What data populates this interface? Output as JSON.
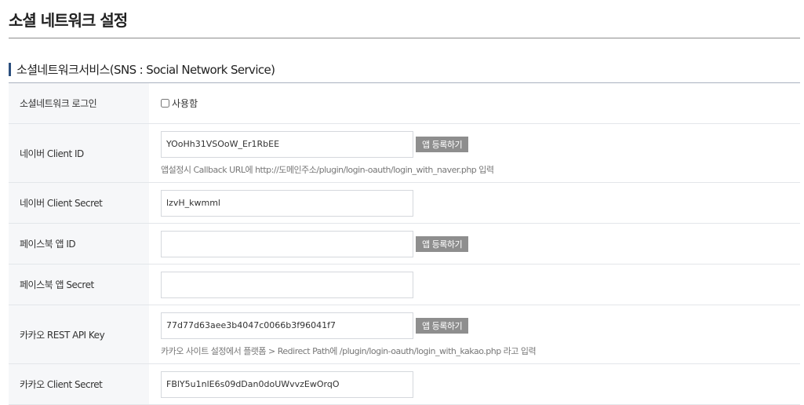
{
  "page": {
    "title": "소셜 네트워크 설정"
  },
  "section": {
    "title": "소셜네트워크서비스(SNS : Social Network Service)"
  },
  "rows": {
    "social_login": {
      "label": "소셜네트워크 로그인",
      "checkbox_label": "사용함",
      "checked": false
    },
    "naver_client_id": {
      "label": "네이버 Client ID",
      "value": "YOoHh31VSOoW_Er1RbEE",
      "button": "앱 등록하기",
      "help": "앱설정시 Callback URL에 http://도메인주소/plugin/login-oauth/login_with_naver.php 입력"
    },
    "naver_client_secret": {
      "label": "네이버 Client Secret",
      "value": "lzvH_kwmml"
    },
    "facebook_app_id": {
      "label": "페이스북 앱 ID",
      "value": "",
      "button": "앱 등록하기"
    },
    "facebook_app_secret": {
      "label": "페이스북 앱 Secret",
      "value": ""
    },
    "kakao_rest_api_key": {
      "label": "카카오 REST API Key",
      "value": "77d77d63aee3b4047c0066b3f96041f7",
      "button": "앱 등록하기",
      "help": "카카오 사이트 설정에서 플랫폼 > Redirect Path에 /plugin/login-oauth/login_with_kakao.php 라고 입력"
    },
    "kakao_client_secret": {
      "label": "카카오 Client Secret",
      "value": "FBlY5u1nlE6s09dDan0doUWvvzEwOrqO"
    }
  },
  "colors": {
    "section_accent": "#2b4f7e",
    "button_bg": "#8e8e8e",
    "label_bg": "#f6f7f9"
  }
}
